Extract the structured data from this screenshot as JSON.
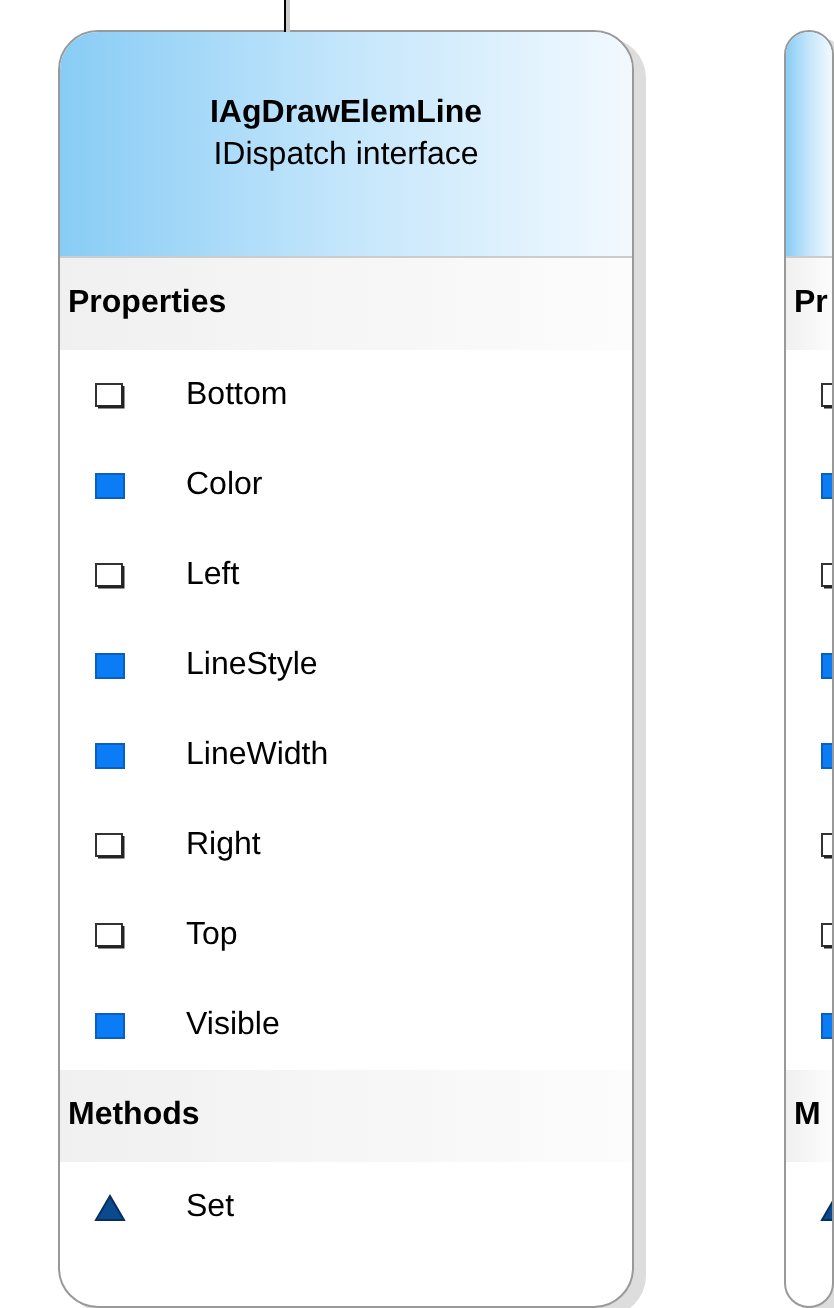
{
  "cards": [
    {
      "title": "IAgDrawElemLine",
      "subtitle": "IDispatch interface",
      "sections": [
        {
          "heading": "Properties",
          "items": [
            {
              "kind": "outline",
              "label": "Bottom"
            },
            {
              "kind": "filled",
              "label": "Color"
            },
            {
              "kind": "outline",
              "label": "Left"
            },
            {
              "kind": "filled",
              "label": "LineStyle"
            },
            {
              "kind": "filled",
              "label": "LineWidth"
            },
            {
              "kind": "outline",
              "label": "Right"
            },
            {
              "kind": "outline",
              "label": "Top"
            },
            {
              "kind": "filled",
              "label": "Visible"
            }
          ]
        },
        {
          "heading": "Methods",
          "items": [
            {
              "kind": "method",
              "label": "Set"
            }
          ]
        }
      ]
    },
    {
      "sections": [
        {
          "heading": "Pr",
          "items": [
            {
              "kind": "outline"
            },
            {
              "kind": "filled"
            },
            {
              "kind": "outline"
            },
            {
              "kind": "filled"
            },
            {
              "kind": "filled"
            },
            {
              "kind": "outline"
            },
            {
              "kind": "outline"
            },
            {
              "kind": "filled"
            }
          ]
        },
        {
          "heading": "M",
          "items": [
            {
              "kind": "method"
            }
          ]
        }
      ]
    }
  ]
}
